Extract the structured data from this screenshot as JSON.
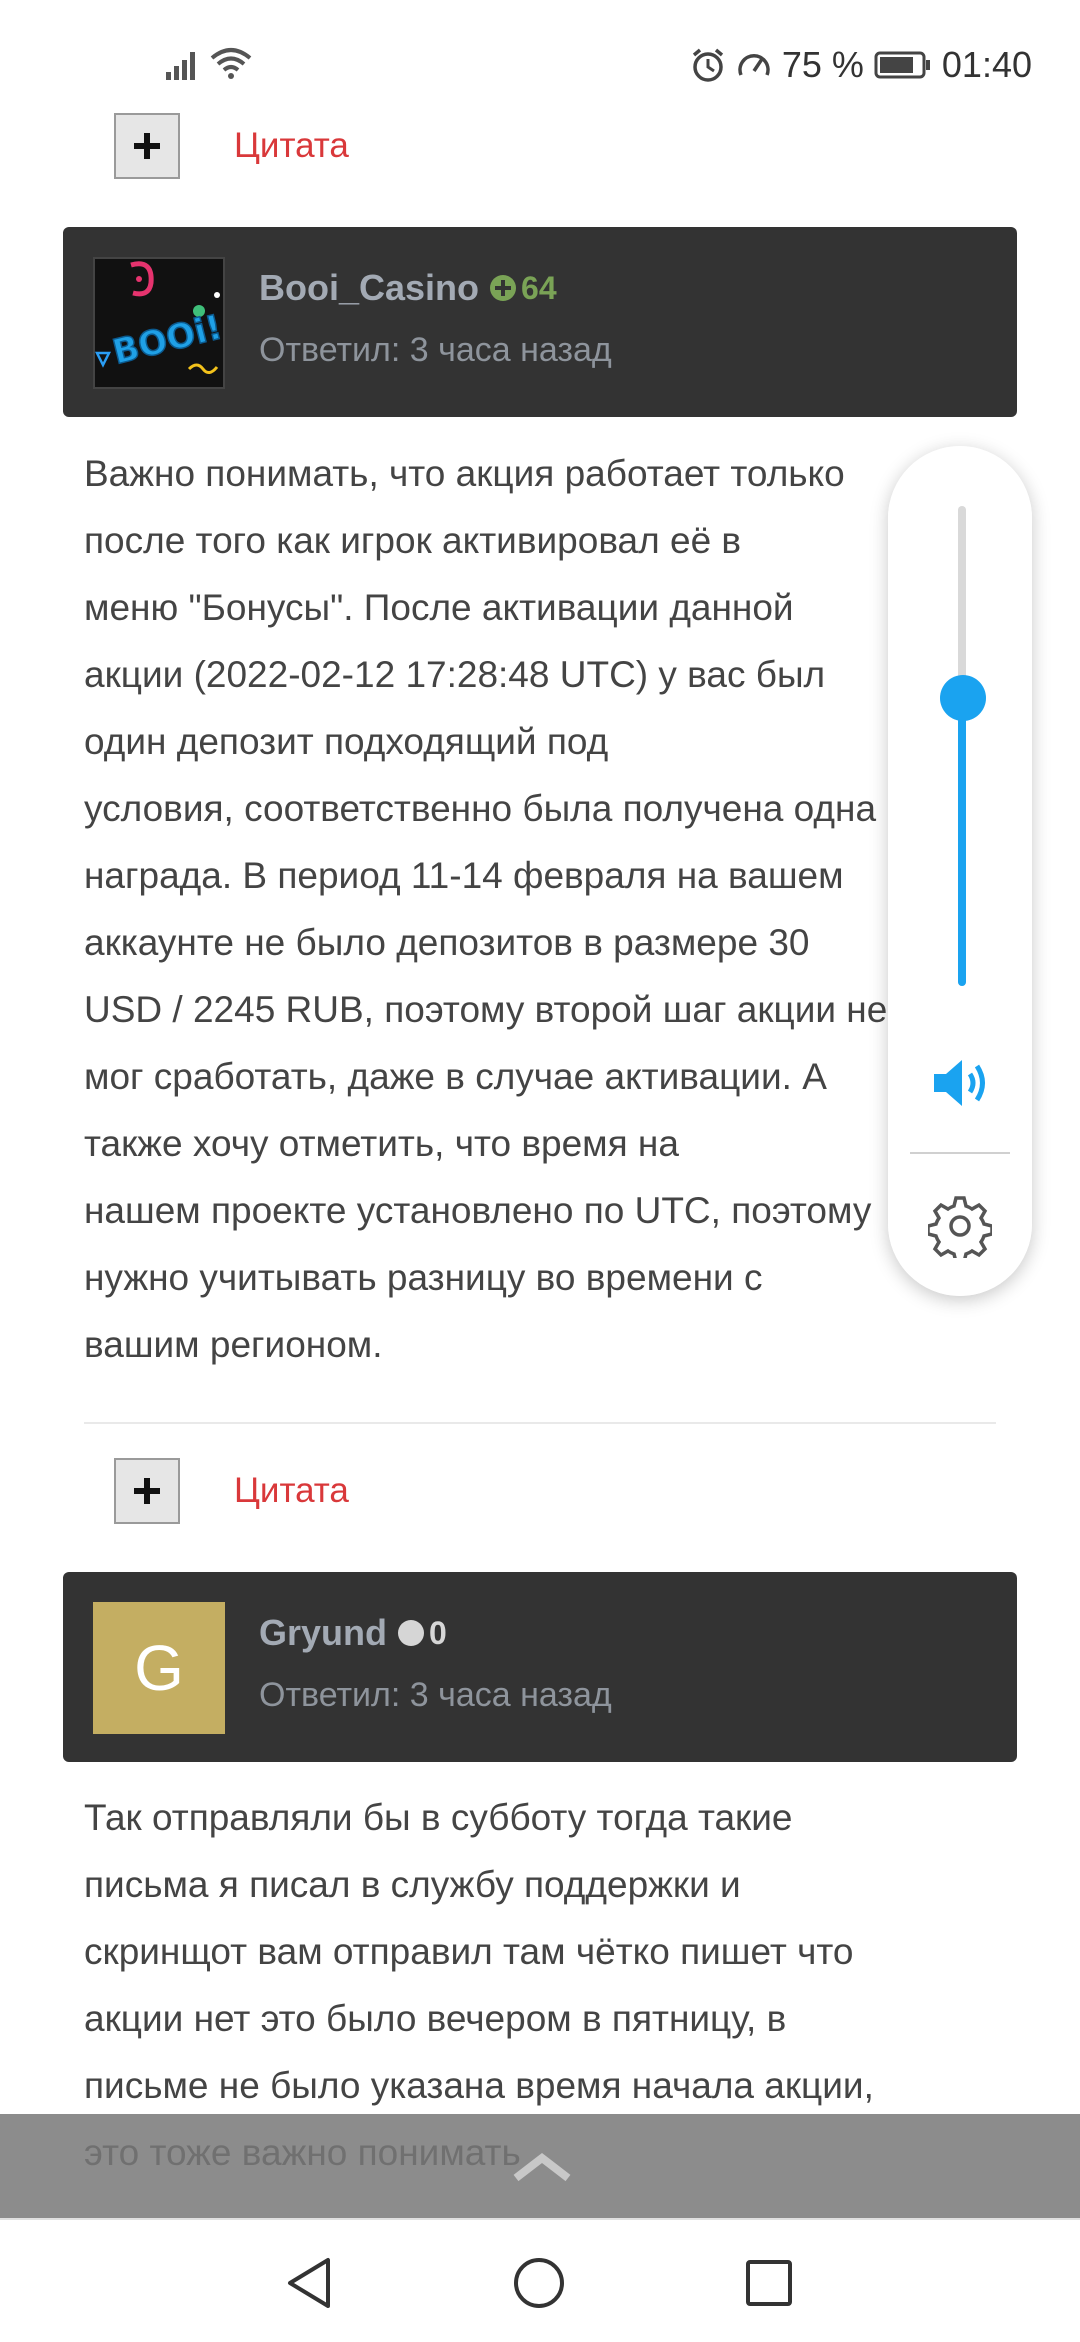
{
  "status_bar": {
    "battery_percent": "75 %",
    "time": "01:40",
    "icons": [
      "signal-icon",
      "wifi-icon",
      "alarm-icon",
      "speed-icon",
      "battery-icon"
    ]
  },
  "posts": [
    {
      "quote_label": "Цитата",
      "username": "Booi_Casino",
      "score": "64",
      "reply_time": "Ответил: 3 часа назад",
      "avatar_type": "booi-logo",
      "body_lines": [
        "Важно понимать, что акция работает только",
        "после того как игрок активировал её в",
        "меню \"Бонусы\". После активации данной",
        "акции (2022-02-12 17:28:48 UTC) у вас был",
        "один депозит подходящий под",
        "условия, соответственно была получена одна",
        "награда. В период 11-14 февраля на вашем",
        "аккаунте не было депозитов в размере 30",
        "USD / 2245 RUB, поэтому второй шаг акции не",
        "мог сработать, даже в случае активации. А",
        "также хочу отметить, что время на",
        "нашем проекте установлено по UTC, поэтому",
        "нужно учитывать разницу во времени с",
        "вашим регионом."
      ]
    },
    {
      "quote_label": "Цитата",
      "username": "Gryund",
      "score": "0",
      "reply_time": "Ответил: 3 часа назад",
      "avatar_letter": "G",
      "body_lines": [
        "Так отправляли бы в субботу тогда такие",
        "письма я писал в службу поддержки и",
        "скринщот вам отправил там чётко пишет что",
        "акции нет это было вечером в пятницу, в",
        "письме не было указана время начала акции,",
        "это тоже важно понимать"
      ]
    }
  ],
  "volume_panel": {
    "level": 0.6,
    "accent_color": "#1aa3f0"
  },
  "nav_bar": {
    "buttons": [
      "back-icon",
      "home-icon",
      "recents-icon"
    ]
  }
}
